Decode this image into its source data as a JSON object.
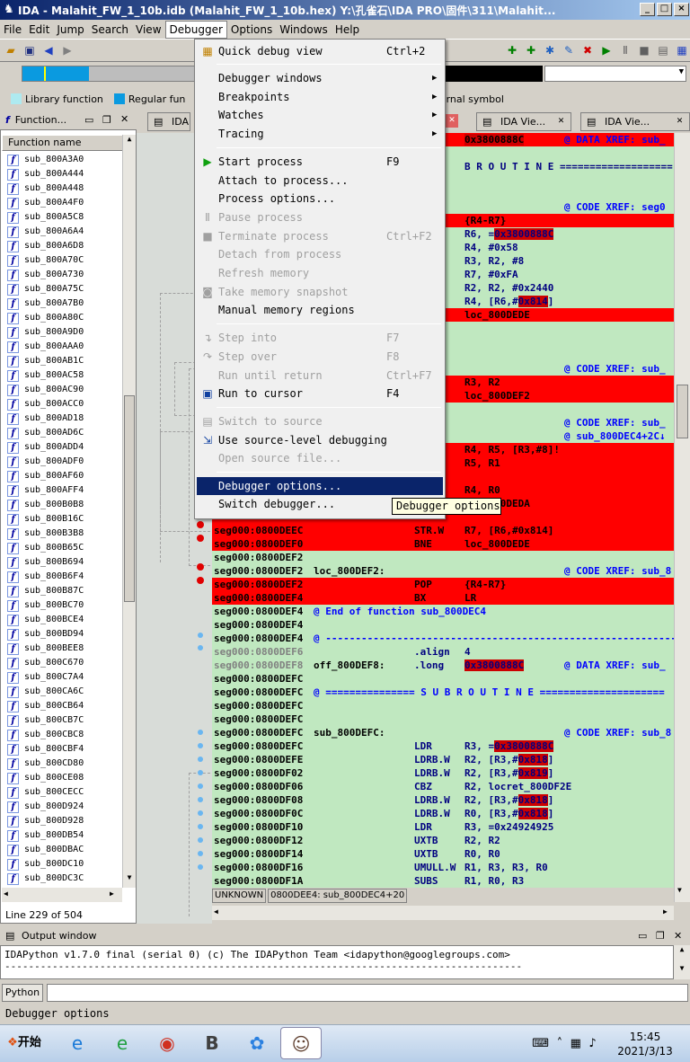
{
  "window": {
    "title": "IDA - Malahit_FW_1_10b.idb (Malahit_FW_1_10b.hex) Y:\\孔雀石\\IDA PRO\\固件\\311\\Malahit...",
    "buttons": [
      "_",
      "□",
      "×"
    ]
  },
  "menubar": [
    "File",
    "Edit",
    "Jump",
    "Search",
    "View",
    "Debugger",
    "Options",
    "Windows",
    "Help"
  ],
  "menubar_active": "Debugger",
  "toolbar": {
    "icons": [
      "open-icon",
      "save-icon",
      "back-icon",
      "forward-icon",
      "play-icon",
      "pause-icon",
      "stop-icon",
      "close-icon"
    ]
  },
  "legend": {
    "items": [
      {
        "label": "Library function",
        "color": "#aeeaf0"
      },
      {
        "label": "Regular function",
        "color": "#0a9ae0"
      },
      {
        "label": "External symbol",
        "color": "#ff80ff"
      }
    ]
  },
  "function_panel": {
    "title": "Function...",
    "column": "Function name",
    "items": [
      "sub_800A3A0",
      "sub_800A444",
      "sub_800A448",
      "sub_800A4F0",
      "sub_800A5C8",
      "sub_800A6A4",
      "sub_800A6D8",
      "sub_800A70C",
      "sub_800A730",
      "sub_800A75C",
      "sub_800A7B0",
      "sub_800A80C",
      "sub_800A9D0",
      "sub_800AAA0",
      "sub_800AB1C",
      "sub_800AC58",
      "sub_800AC90",
      "sub_800ACC0",
      "sub_800AD18",
      "sub_800AD6C",
      "sub_800ADD4",
      "sub_800ADF0",
      "sub_800AF60",
      "sub_800AFF4",
      "sub_800B0B8",
      "sub_800B16C",
      "sub_800B3B8",
      "sub_800B65C",
      "sub_800B694",
      "sub_800B6F4",
      "sub_800B87C",
      "sub_800BC70",
      "sub_800BCE4",
      "sub_800BD94",
      "sub_800BEE8",
      "sub_800C670",
      "sub_800C7A4",
      "sub_800CA6C",
      "sub_800CB64",
      "sub_800CB7C",
      "sub_800CBC8",
      "sub_800CBF4",
      "sub_800CD80",
      "sub_800CE08",
      "sub_800CECC",
      "sub_800D924",
      "sub_800D928",
      "sub_800DB54",
      "sub_800DBAC",
      "sub_800DC10",
      "sub_800DC3C"
    ],
    "status": "Line 229 of 504"
  },
  "tabs": [
    {
      "label": "IDA V"
    },
    {
      "label": "IDA Vie..."
    },
    {
      "label": "IDA Vie..."
    }
  ],
  "code": {
    "lines": [
      {
        "red": true,
        "addr": "",
        "c1": "",
        "c2": "",
        "c3": "",
        "hl3": "0x3800888C",
        "cm": "@ DATA XREF: sub_"
      },
      {
        "red": false,
        "addr": "",
        "c1": "",
        "c2": "",
        "c3": "",
        "cm": ""
      },
      {
        "red": false,
        "addr": "",
        "c1": "",
        "c2": "",
        "c3": "B R O U T I N E ===================",
        "cm": ""
      },
      {
        "red": false,
        "addr": "",
        "c1": "",
        "c2": "",
        "c3": "",
        "cm": ""
      },
      {
        "red": false,
        "addr": "",
        "c1": "",
        "c2": "",
        "c3": "",
        "cm": ""
      },
      {
        "red": false,
        "addr": "",
        "c1": "",
        "c2": "",
        "c3": "",
        "cm": "@ CODE XREF: seg0"
      },
      {
        "red": true,
        "addr": "",
        "c1": "",
        "c2": "",
        "c3": "{R4-R7}",
        "cm": ""
      },
      {
        "red": false,
        "addr": "",
        "c1": "",
        "c2": "",
        "c3": "R6, =",
        "hl3": "0x3800888C",
        "cm": ""
      },
      {
        "red": false,
        "addr": "",
        "c1": "",
        "c2": "",
        "c3": "R4, #0x58",
        "cm": ""
      },
      {
        "red": false,
        "addr": "",
        "c1": "",
        "c2": "",
        "c3": "R3, R2, #8",
        "cm": ""
      },
      {
        "red": false,
        "addr": "",
        "c1": "",
        "c2": "",
        "c3": "R7, #0xFA",
        "cm": ""
      },
      {
        "red": false,
        "addr": "",
        "c1": "",
        "c2": "",
        "c3": "R2, R2, #0x2440",
        "cm": ""
      },
      {
        "red": false,
        "addr": "",
        "c1": "",
        "c2": "",
        "c3": "R4, [R6,#",
        "hl3": "0x814",
        "tail": "]",
        "cm": ""
      },
      {
        "red": true,
        "addr": "",
        "c1": "",
        "c2": "",
        "c3": "loc_800DEDE",
        "cm": ""
      },
      {
        "red": false,
        "addr": "",
        "c1": "",
        "c2": "",
        "c3": "",
        "cm": ""
      },
      {
        "red": false,
        "addr": "",
        "c1": "",
        "c2": "",
        "c3": "",
        "cm": ""
      },
      {
        "red": false,
        "addr": "",
        "c1": "",
        "c2": "",
        "c3": "",
        "cm": ""
      },
      {
        "red": false,
        "addr": "",
        "c1": "",
        "c2": "",
        "c3": "",
        "cm": "@ CODE XREF: sub_"
      },
      {
        "red": true,
        "addr": "",
        "c1": "",
        "c2": "",
        "c3": "R3, R2",
        "cm": ""
      },
      {
        "red": true,
        "addr": "",
        "c1": "",
        "c2": "",
        "c3": "loc_800DEF2",
        "cm": ""
      },
      {
        "red": false,
        "addr": "",
        "c1": "",
        "c2": "",
        "c3": "",
        "cm": ""
      },
      {
        "red": false,
        "addr": "",
        "c1": "",
        "c2": "",
        "c3": "",
        "cm": "@ CODE XREF: sub_"
      },
      {
        "red": false,
        "addr": "",
        "c1": "",
        "c2": "",
        "c3": "",
        "cm": "@ sub_800DEC4+2C↓"
      },
      {
        "red": true,
        "addr": "",
        "c1": "",
        "c2": "W",
        "c3": "R4, R5, [R3,#8]!",
        "cm": ""
      },
      {
        "red": true,
        "addr": "",
        "c1": "",
        "c2": "",
        "c3": "R5, R1",
        "cm": ""
      },
      {
        "red": true,
        "addr": "",
        "c1": "",
        "c2": "",
        "c3": "",
        "cm": ""
      },
      {
        "red": true,
        "addr": "",
        "c1": "",
        "c2": "",
        "c3": "R4, R0",
        "cm": ""
      },
      {
        "red": true,
        "addr": "",
        "c1": "",
        "c2": "",
        "c3": "loc_800DEDA",
        "cm": ""
      },
      {
        "red": true,
        "addr": "",
        "c1": "",
        "c2": "",
        "c3": "",
        "cm": ""
      },
      {
        "red": true,
        "addr": "seg000:0800DEEC",
        "c1": "",
        "c2": "STR.W",
        "c3": "R7, [R6,#0x814]",
        "cm": ""
      },
      {
        "red": true,
        "addr": "seg000:0800DEF0",
        "c1": "",
        "c2": "BNE",
        "c3": "loc_800DEDE",
        "cm": ""
      },
      {
        "red": false,
        "addr": "seg000:0800DEF2",
        "c1": "",
        "c2": "",
        "c3": "",
        "cm": ""
      },
      {
        "red": false,
        "addr": "seg000:0800DEF2",
        "c1": "loc_800DEF2:",
        "c2": "",
        "c3": "",
        "cm": "@ CODE XREF: sub_8"
      },
      {
        "red": true,
        "addr": "seg000:0800DEF2",
        "c1": "",
        "c2": "POP",
        "c3": "{R4-R7}",
        "cm": ""
      },
      {
        "red": true,
        "addr": "seg000:0800DEF4",
        "c1": "",
        "c2": "BX",
        "c3": "LR",
        "cm": ""
      },
      {
        "red": false,
        "addr": "seg000:0800DEF4",
        "cmt": "@ End of function sub_800DEC4"
      },
      {
        "red": false,
        "addr": "seg000:0800DEF4",
        "c1": "",
        "c2": "",
        "c3": "",
        "cm": ""
      },
      {
        "red": false,
        "addr": "seg000:0800DEF4",
        "cmt": "@ -------------------------------------------------------------------"
      },
      {
        "red": false,
        "addr": "seg000:0800DEF6",
        "gray": true,
        "c1": "",
        "c2": ".align",
        "c3": "4",
        "cm": ""
      },
      {
        "red": false,
        "addr": "seg000:0800DEF8",
        "gray": true,
        "c1": "off_800DEF8:",
        "c2": ".long",
        "c3": "",
        "hl3": "0x3800888C",
        "cm": "@ DATA XREF: sub_"
      },
      {
        "red": false,
        "addr": "seg000:0800DEFC",
        "c1": "",
        "c2": "",
        "c3": "",
        "cm": ""
      },
      {
        "red": false,
        "addr": "seg000:0800DEFC",
        "cmt": "@ =============== S U B R O U T I N E ====================="
      },
      {
        "red": false,
        "addr": "seg000:0800DEFC",
        "c1": "",
        "c2": "",
        "c3": "",
        "cm": ""
      },
      {
        "red": false,
        "addr": "seg000:0800DEFC",
        "c1": "",
        "c2": "",
        "c3": "",
        "cm": ""
      },
      {
        "red": false,
        "addr": "seg000:0800DEFC",
        "c1": "sub_800DEFC:",
        "c2": "",
        "c3": "",
        "cm": "@ CODE XREF: sub_8"
      },
      {
        "red": false,
        "addr": "seg000:0800DEFC",
        "c1": "",
        "c2": "LDR",
        "c3": "R3, =",
        "hl3": "0x3800888C",
        "cm": ""
      },
      {
        "red": false,
        "addr": "seg000:0800DEFE",
        "c1": "",
        "c2": "LDRB.W",
        "c3": "R2, [R3,#",
        "hl3": "0x818",
        "tail": "]",
        "cm": ""
      },
      {
        "red": false,
        "addr": "seg000:0800DF02",
        "c1": "",
        "c2": "LDRB.W",
        "c3": "R2, [R3,#",
        "hl3": "0x819",
        "tail": "]",
        "cm": ""
      },
      {
        "red": false,
        "addr": "seg000:0800DF06",
        "c1": "",
        "c2": "CBZ",
        "c3": "R2, locret_800DF2E",
        "cm": ""
      },
      {
        "red": false,
        "addr": "seg000:0800DF08",
        "c1": "",
        "c2": "LDRB.W",
        "c3": "R2, [R3,#",
        "hl3": "0x818",
        "tail": "]",
        "cm": ""
      },
      {
        "red": false,
        "addr": "seg000:0800DF0C",
        "c1": "",
        "c2": "LDRB.W",
        "c3": "R0, [R3,#",
        "hl3": "0x818",
        "tail": "]",
        "cm": ""
      },
      {
        "red": false,
        "addr": "seg000:0800DF10",
        "c1": "",
        "c2": "LDR",
        "c3": "R3, =0x24924925",
        "cm": ""
      },
      {
        "red": false,
        "addr": "seg000:0800DF12",
        "c1": "",
        "c2": "UXTB",
        "c3": "R2, R2",
        "cm": ""
      },
      {
        "red": false,
        "addr": "seg000:0800DF14",
        "c1": "",
        "c2": "UXTB",
        "c3": "R0, R0",
        "cm": ""
      },
      {
        "red": false,
        "addr": "seg000:0800DF16",
        "c1": "",
        "c2": "UMULL.W",
        "c3": "R1, R3, R3, R0",
        "cm": ""
      },
      {
        "red": false,
        "addr": "seg000:0800DF1A",
        "c1": "",
        "c2": "SUBS",
        "c3": "R1, R0, R3",
        "cm": ""
      }
    ],
    "status": [
      "UNKNOWN",
      "0800DEE4: sub_800DEC4+20"
    ]
  },
  "debugger_menu": {
    "items": [
      {
        "type": "item",
        "label": "Quick debug view",
        "shortcut": "Ctrl+2",
        "icon": "debug-view-icon",
        "enabled": true
      },
      {
        "type": "sep"
      },
      {
        "type": "item",
        "label": "Debugger windows",
        "submenu": true,
        "enabled": true
      },
      {
        "type": "item",
        "label": "Breakpoints",
        "submenu": true,
        "enabled": true
      },
      {
        "type": "item",
        "label": "Watches",
        "submenu": true,
        "enabled": true
      },
      {
        "type": "item",
        "label": "Tracing",
        "submenu": true,
        "enabled": true
      },
      {
        "type": "sep"
      },
      {
        "type": "item",
        "label": "Start process",
        "shortcut": "F9",
        "icon": "play-icon",
        "enabled": true
      },
      {
        "type": "item",
        "label": "Attach to process...",
        "enabled": true
      },
      {
        "type": "item",
        "label": "Process options...",
        "enabled": true
      },
      {
        "type": "item",
        "label": "Pause process",
        "icon": "pause-icon",
        "enabled": false
      },
      {
        "type": "item",
        "label": "Terminate process",
        "shortcut": "Ctrl+F2",
        "icon": "stop-icon",
        "enabled": false
      },
      {
        "type": "item",
        "label": "Detach from process",
        "enabled": false
      },
      {
        "type": "item",
        "label": "Refresh memory",
        "enabled": false
      },
      {
        "type": "item",
        "label": "Take memory snapshot",
        "icon": "camera-icon",
        "enabled": false
      },
      {
        "type": "item",
        "label": "Manual memory regions",
        "enabled": true
      },
      {
        "type": "sep"
      },
      {
        "type": "item",
        "label": "Step into",
        "shortcut": "F7",
        "icon": "step-into-icon",
        "enabled": false
      },
      {
        "type": "item",
        "label": "Step over",
        "shortcut": "F8",
        "icon": "step-over-icon",
        "enabled": false
      },
      {
        "type": "item",
        "label": "Run until return",
        "shortcut": "Ctrl+F7",
        "enabled": false
      },
      {
        "type": "item",
        "label": "Run to cursor",
        "shortcut": "F4",
        "icon": "run-to-cursor-icon",
        "enabled": true
      },
      {
        "type": "sep"
      },
      {
        "type": "item",
        "label": "Switch to source",
        "icon": "source-icon",
        "enabled": false
      },
      {
        "type": "item",
        "label": "Use source-level debugging",
        "icon": "source-debug-icon",
        "enabled": true
      },
      {
        "type": "item",
        "label": "Open source file...",
        "enabled": false
      },
      {
        "type": "sep"
      },
      {
        "type": "item",
        "label": "Debugger options...",
        "enabled": true,
        "selected": true
      },
      {
        "type": "item",
        "label": "Switch debugger...",
        "enabled": true
      }
    ]
  },
  "tooltip": "Debugger options",
  "output": {
    "title": "Output window",
    "lines": "IDAPython v1.7.0 final (serial 0) (c) The IDAPython Team <idapython@googlegroups.com>\n---------------------------------------------------------------------------------------"
  },
  "python_button": "Python",
  "statusbar": "Debugger options",
  "taskbar": {
    "start": "开始",
    "apps": [
      "ie-icon",
      "ie-green-icon",
      "chrome-icon",
      "b-app-icon",
      "ali-icon",
      "portrait-icon"
    ],
    "time": "15:45",
    "date": "2021/3/13"
  }
}
